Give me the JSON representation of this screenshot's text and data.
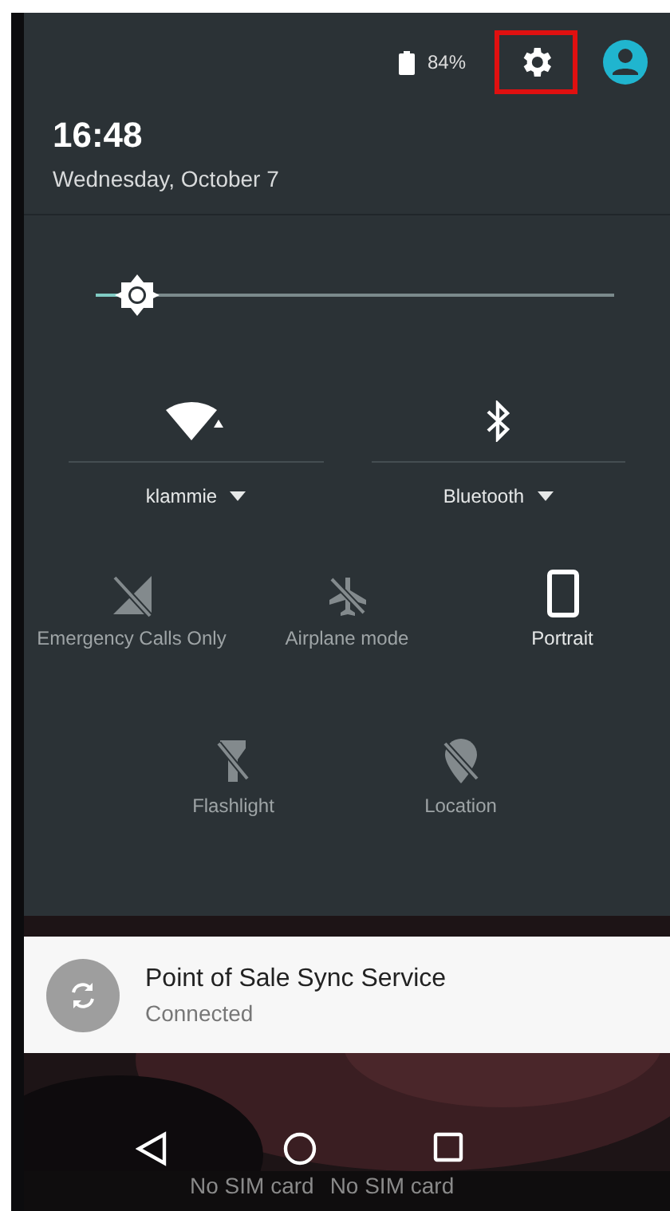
{
  "status_bar": {
    "battery": "84%",
    "settings": {
      "highlighted": true
    }
  },
  "header": {
    "time": "16:48",
    "date": "Wednesday, October 7"
  },
  "brightness": {
    "level": 0.08
  },
  "tiles": [
    {
      "kind": "dual",
      "label": "klammie",
      "on": true
    },
    {
      "kind": "dual",
      "label": "Bluetooth",
      "on": true
    },
    {
      "kind": "toggle",
      "label": "Emergency Calls Only",
      "on": false
    },
    {
      "kind": "toggle",
      "label": "Airplane mode",
      "on": false
    },
    {
      "kind": "toggle",
      "label": "Portrait",
      "on": true
    },
    {
      "kind": "toggle",
      "label": "Flashlight",
      "on": false
    },
    {
      "kind": "toggle",
      "label": "Location",
      "on": false
    }
  ],
  "notification": {
    "title": "Point of Sale Sync Service",
    "text": "Connected"
  },
  "carrier_labels": [
    "No SIM card",
    "No SIM card"
  ]
}
